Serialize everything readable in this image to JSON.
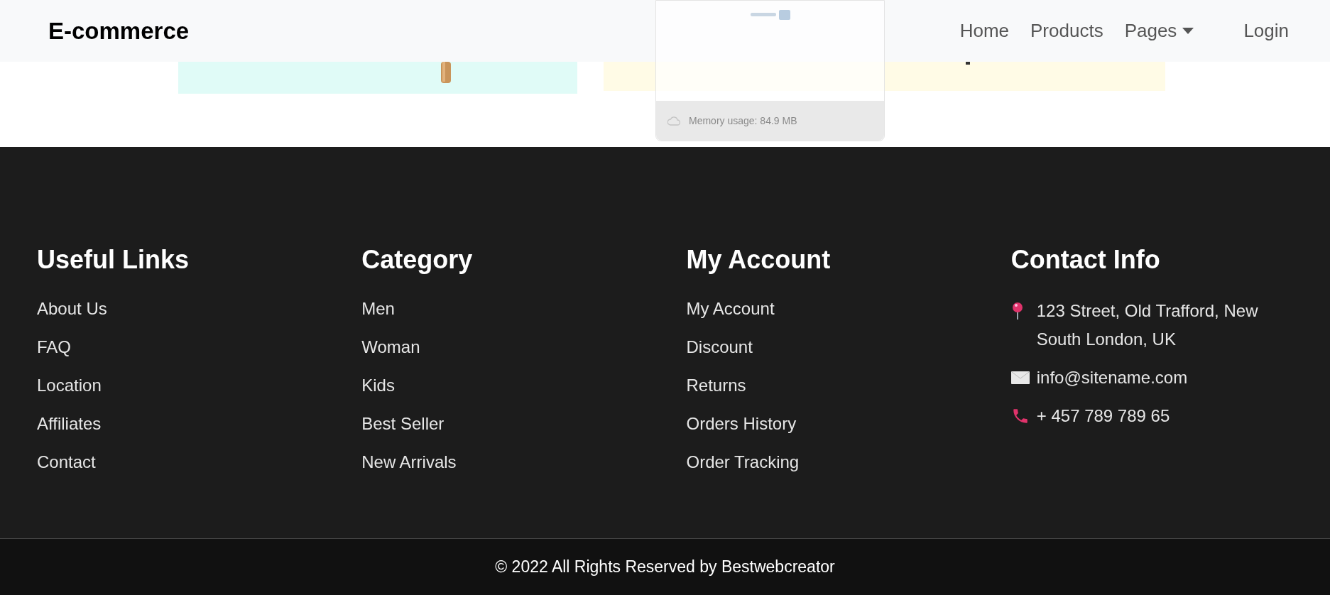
{
  "navbar": {
    "brand": "E-commerce",
    "links": [
      {
        "label": "Home",
        "dropdown": false
      },
      {
        "label": "Products",
        "dropdown": false
      },
      {
        "label": "Pages",
        "dropdown": true
      }
    ],
    "login": "Login"
  },
  "overlay": {
    "memory": "Memory usage: 84.9 MB"
  },
  "footer": {
    "columns": [
      {
        "title": "Useful Links",
        "links": [
          "About Us",
          "FAQ",
          "Location",
          "Affiliates",
          "Contact"
        ]
      },
      {
        "title": "Category",
        "links": [
          "Men",
          "Woman",
          "Kids",
          "Best Seller",
          "New Arrivals"
        ]
      },
      {
        "title": "My Account",
        "links": [
          "My Account",
          "Discount",
          "Returns",
          "Orders History",
          "Order Tracking"
        ]
      }
    ],
    "contact": {
      "title": "Contact Info",
      "items": [
        {
          "kind": "address",
          "text": "123 Street, Old Trafford, New South London, UK"
        },
        {
          "kind": "email",
          "text": "info@sitename.com"
        },
        {
          "kind": "phone",
          "text": "+ 457 789 789 65"
        }
      ]
    },
    "copyright": "© 2022 All Rights Reserved by Bestwebcreator"
  }
}
